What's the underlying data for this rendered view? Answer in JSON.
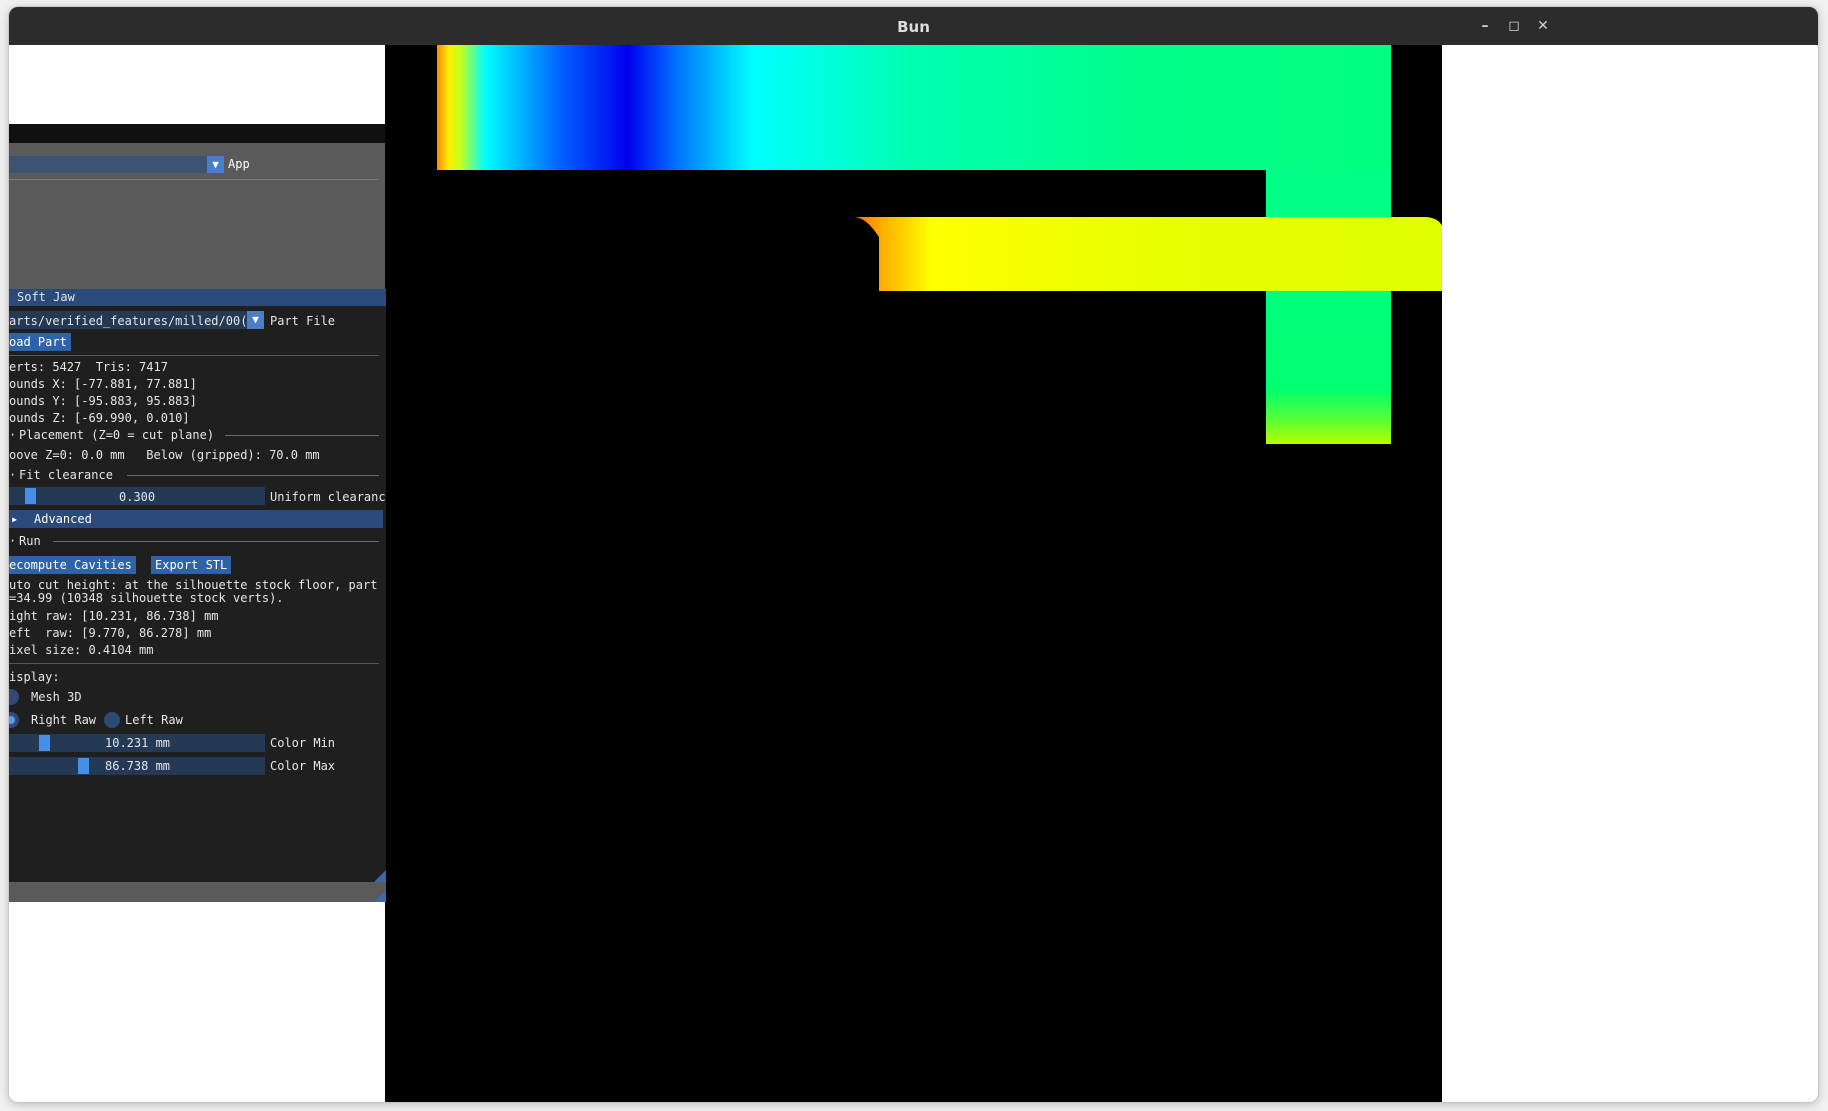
{
  "window": {
    "title": "Bun",
    "minimize": "–",
    "maximize": "◻",
    "close": "✕"
  },
  "app_panel": {
    "combo_value": "",
    "label": "App"
  },
  "soft_jaw": {
    "header": "Soft Jaw",
    "part_file_value": "arts/verified_features/milled/00(",
    "part_file_label": "Part File",
    "load_part": "oad Part",
    "stats": {
      "verts_tris": "erts: 5427  Tris: 7417",
      "bounds_x": "ounds X: [-77.881, 77.881]",
      "bounds_y": "ounds Y: [-95.883, 95.883]",
      "bounds_z": "ounds Z: [-69.990, 0.010]"
    },
    "placement_header": "Placement (Z=0 = cut plane)",
    "placement_text": "oove Z=0: 0.0 mm   Below (gripped): 70.0 mm",
    "fit_header": "Fit clearance",
    "clearance_value": "0.300",
    "clearance_label": "Uniform clearance",
    "advanced": "Advanced",
    "run_header": "Run",
    "recompute_button": "ecompute Cavities",
    "export_button": "Export STL",
    "auto_cut_1": "uto cut height: at the silhouette stock floor, part",
    "auto_cut_2": "=34.99 (10348 silhouette stock verts).",
    "right_raw": "ight raw: [10.231, 86.738] mm",
    "left_raw": "eft  raw: [9.770, 86.278] mm",
    "pixel_size": "ixel size: 0.4104 mm",
    "display_label": "isplay:",
    "mesh_3d": "Mesh 3D",
    "right_raw_radio": "Right Raw",
    "left_raw_radio": "Left Raw",
    "color_min_value": "10.231 mm",
    "color_min_label": "Color Min",
    "color_max_value": "86.738 mm",
    "color_max_label": "Color Max",
    "selected_display": "Right Raw"
  },
  "viewport": {
    "background": "#000000",
    "colormap": [
      "#0000ff",
      "#00ffff",
      "#00ff80",
      "#ffff00",
      "#ff0000"
    ]
  }
}
